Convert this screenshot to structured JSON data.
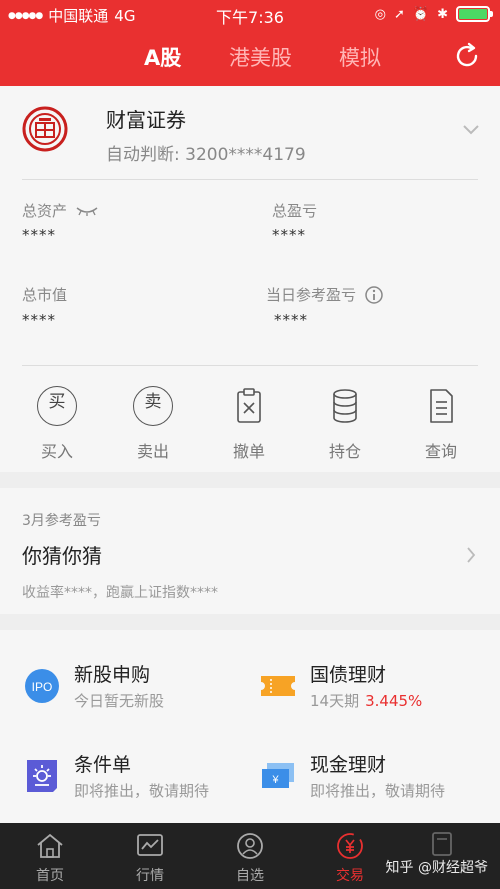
{
  "status_bar": {
    "carrier": "中国联通",
    "network": "4G",
    "time": "下午7:36",
    "battery_level": 1.0
  },
  "header": {
    "tabs": [
      {
        "label": "A股",
        "active": true
      },
      {
        "label": "港美股",
        "active": false
      },
      {
        "label": "模拟",
        "active": false
      }
    ],
    "refresh_icon": "refresh-icon"
  },
  "account": {
    "broker_name": "财富证券",
    "account_line": "自动判断: 3200****4179",
    "stats": {
      "total_assets_label": "总资产",
      "total_assets_value": "****",
      "total_profit_label": "总盈亏",
      "total_profit_value": "****",
      "market_value_label": "总市值",
      "market_value_value": "****",
      "daily_profit_label": "当日参考盈亏",
      "daily_profit_value": "****"
    },
    "actions": [
      {
        "label": "买入",
        "glyph": "买"
      },
      {
        "label": "卖出",
        "glyph": "卖"
      },
      {
        "label": "撤单"
      },
      {
        "label": "持仓"
      },
      {
        "label": "查询"
      }
    ]
  },
  "monthly_profit": {
    "subtitle": "3月参考盈亏",
    "headline": "你猜你猜",
    "note": "收益率****，跑赢上证指数****"
  },
  "services": [
    {
      "title": "新股申购",
      "desc": "今日暂无新股",
      "icon_text": "IPO"
    },
    {
      "title": "国债理财",
      "desc": "14天期",
      "rate": "3.445%"
    },
    {
      "title": "条件单",
      "desc": "即将推出，敬请期待"
    },
    {
      "title": "现金理财",
      "desc": "即将推出，敬请期待",
      "icon_text": "¥"
    }
  ],
  "bottom_nav": [
    {
      "label": "首页",
      "active": false
    },
    {
      "label": "行情",
      "active": false
    },
    {
      "label": "自选",
      "active": false
    },
    {
      "label": "交易",
      "active": true
    }
  ],
  "watermark": "知乎 @财经超爷",
  "colors": {
    "brand_red": "#e93030",
    "battery_green": "#4cd964",
    "ipo_blue": "#3b8ee8",
    "bond_orange": "#f7a325",
    "condition_purple": "#5b5bd6",
    "cash_blue": "#3b8ee8"
  }
}
